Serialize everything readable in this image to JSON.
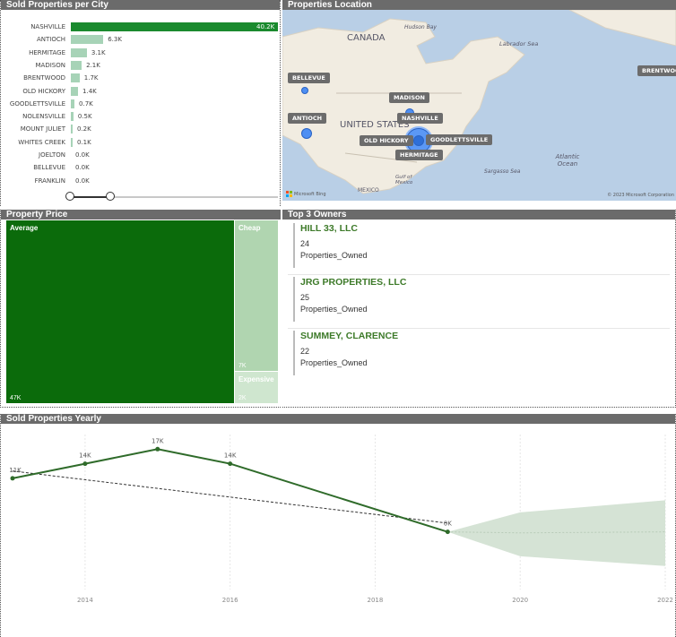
{
  "sold_per_city": {
    "title": "Sold Properties per City",
    "chart_data": {
      "type": "bar",
      "categories": [
        "NASHVILLE",
        "ANTIOCH",
        "HERMITAGE",
        "MADISON",
        "BRENTWOOD",
        "OLD HICKORY",
        "GOODLETTSVILLE",
        "NOLENSVILLE",
        "MOUNT JULIET",
        "WHITES CREEK",
        "JOELTON",
        "BELLEVUE",
        "FRANKLIN"
      ],
      "values": [
        40.2,
        6.3,
        3.1,
        2.1,
        1.7,
        1.4,
        0.7,
        0.5,
        0.2,
        0.1,
        0.0,
        0.0,
        0.0
      ],
      "value_labels": [
        "40.2K",
        "6.3K",
        "3.1K",
        "2.1K",
        "1.7K",
        "1.4K",
        "0.7K",
        "0.5K",
        "0.2K",
        "0.1K",
        "0.0K",
        "0.0K",
        "0.0K"
      ],
      "unit": "K",
      "xlim": [
        0,
        40.2
      ],
      "highlight_color": "#1a8a2e",
      "bar_color": "#a7d3b7"
    }
  },
  "location": {
    "title": "Properties Location",
    "region_labels": [
      "CANADA",
      "UNITED STATES",
      "MEXICO"
    ],
    "water_labels": [
      "Hudson Bay",
      "Labrador Sea",
      "Atlantic Ocean",
      "Gulf of Mexico",
      "Sargasso Sea"
    ],
    "city_labels": [
      "BELLEVUE",
      "ANTIOCH",
      "MADISON",
      "NASHVILLE",
      "OLD HICKORY",
      "GOODLETTSVILLE",
      "HERMITAGE",
      "BRENTWOOD"
    ],
    "attribution": "Microsoft Bing",
    "copyright": "© 2023 Microsoft Corporation"
  },
  "property_price": {
    "title": "Property Price",
    "chart_data": {
      "type": "treemap",
      "categories": [
        "Average",
        "Cheap",
        "Expensive"
      ],
      "values": [
        47,
        7,
        2
      ],
      "value_labels": [
        "47K",
        "7K",
        "2K"
      ],
      "colors": [
        "#0b6b0b",
        "#b0d5b0",
        "#cfe6cf"
      ]
    }
  },
  "top_owners": {
    "title": "Top 3 Owners",
    "items": [
      {
        "name": "HILL 33, LLC",
        "count": "24",
        "label": "Properties_Owned"
      },
      {
        "name": "JRG PROPERTIES, LLC",
        "count": "25",
        "label": "Properties_Owned"
      },
      {
        "name": "SUMMEY, CLARENCE",
        "count": "22",
        "label": "Properties_Owned"
      }
    ]
  },
  "yearly": {
    "title": "Sold Properties Yearly",
    "chart_data": {
      "type": "line",
      "x": [
        2013,
        2014,
        2015,
        2016,
        2019
      ],
      "y": [
        11,
        14,
        17,
        14,
        0
      ],
      "point_labels": [
        "11K",
        "14K",
        "17K",
        "14K",
        "0K"
      ],
      "x_ticks": [
        "2014",
        "2016",
        "2018",
        "2020",
        "2022"
      ],
      "xlim": [
        2013,
        2022
      ],
      "ylim": [
        -10,
        20
      ],
      "trendline": {
        "x": [
          2013,
          2019
        ],
        "y": [
          12.5,
          1.8
        ]
      },
      "forecast": {
        "x": [
          2019,
          2020,
          2022
        ],
        "upper": [
          0,
          4,
          6.5
        ],
        "lower": [
          0,
          -5,
          -7
        ],
        "mid": [
          0,
          -0.2,
          0
        ]
      },
      "line_color": "#2f6b2a",
      "forecast_color": "#d5e3d5"
    }
  }
}
